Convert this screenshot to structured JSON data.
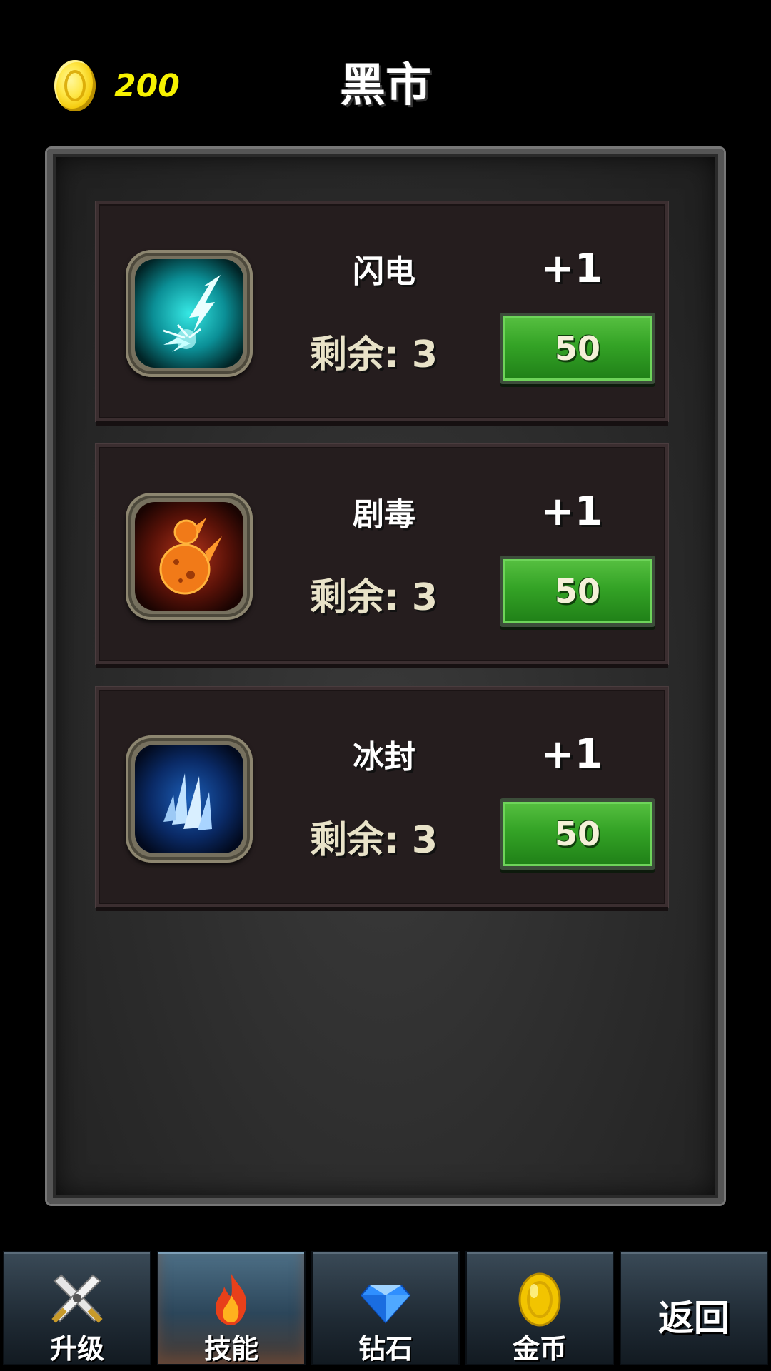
{
  "header": {
    "title": "黑市",
    "coins": "200"
  },
  "skills": [
    {
      "name": "闪电",
      "remaining_label": "剩余: 3",
      "increment": "+1",
      "price": "50",
      "icon": "lightning-icon",
      "color": "#1fc6c8"
    },
    {
      "name": "剧毒",
      "remaining_label": "剩余: 3",
      "increment": "+1",
      "price": "50",
      "icon": "poison-meteor-icon",
      "color": "#e5531f"
    },
    {
      "name": "冰封",
      "remaining_label": "剩余: 3",
      "increment": "+1",
      "price": "50",
      "icon": "ice-spikes-icon",
      "color": "#3a7fe0"
    }
  ],
  "tabs": [
    {
      "label": "升级",
      "icon": "crossed-swords-icon",
      "active": false
    },
    {
      "label": "技能",
      "icon": "fire-icon",
      "active": true
    },
    {
      "label": "钻石",
      "icon": "diamond-icon",
      "active": false
    },
    {
      "label": "金币",
      "icon": "gold-coin-icon",
      "active": false
    },
    {
      "label": "返回",
      "icon": "",
      "active": false
    }
  ],
  "colors": {
    "coin_text": "#f7f200",
    "buy_button": "#34a326",
    "card_bg": "#251d1e"
  }
}
